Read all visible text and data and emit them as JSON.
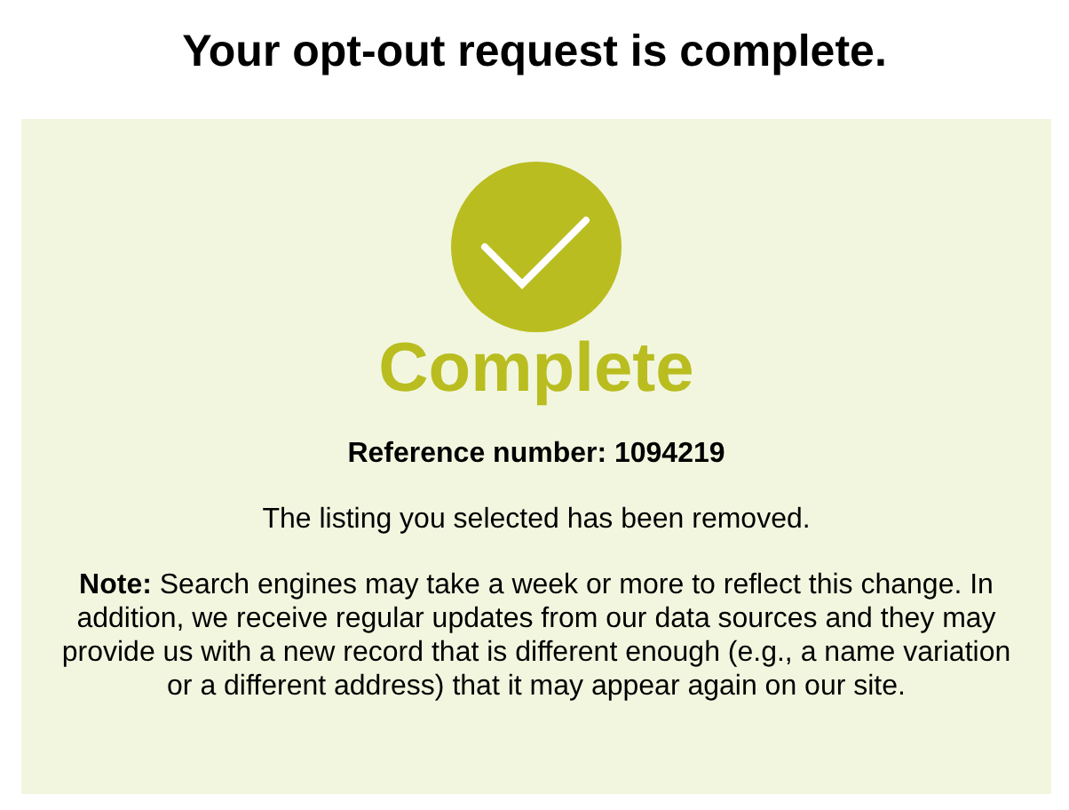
{
  "heading": "Your opt-out request is complete.",
  "panel": {
    "status": "Complete",
    "reference": "Reference number: 1094219",
    "message": "The listing you selected has been removed.",
    "note": "**Note:** Search engines may take a week or more to reflect this change. In addition, we receive regular updates from our data sources and they may provide us with a new record that is different enough (e.g., a name variation or a different address) that it may appear again on our site."
  }
}
